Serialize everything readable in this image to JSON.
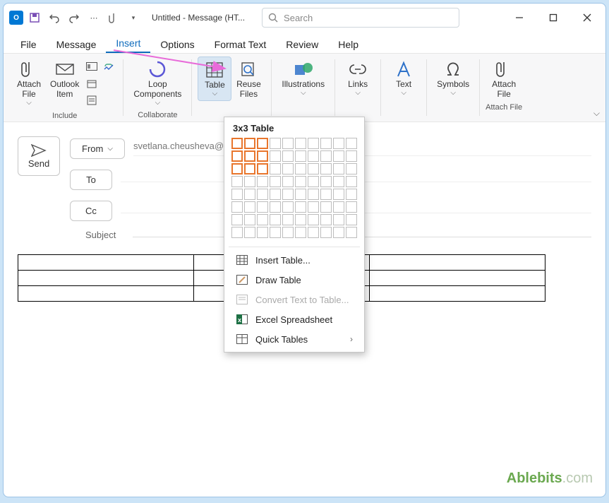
{
  "titlebar": {
    "app_abbr": "O",
    "doc_title": "Untitled - Message (HT...",
    "search_placeholder": "Search"
  },
  "menu": {
    "file": "File",
    "message": "Message",
    "insert": "Insert",
    "options": "Options",
    "format_text": "Format Text",
    "review": "Review",
    "help": "Help"
  },
  "ribbon": {
    "attach_file": "Attach\nFile",
    "outlook_item": "Outlook\nItem",
    "include_label": "Include",
    "loop_components": "Loop\nComponents",
    "collaborate_label": "Collaborate",
    "table": "Table",
    "reuse_files": "Reuse\nFiles",
    "illustrations": "Illustrations",
    "links": "Links",
    "text": "Text",
    "symbols": "Symbols",
    "attach_file2": "Attach\nFile",
    "attach_file_label": "Attach File"
  },
  "compose": {
    "send": "Send",
    "from": "From",
    "to": "To",
    "cc": "Cc",
    "subject": "Subject",
    "from_value": "svetlana.cheusheva@"
  },
  "table_dd": {
    "title": "3x3 Table",
    "sel_rows": 3,
    "sel_cols": 3,
    "insert_table": "Insert Table...",
    "draw_table": "Draw Table",
    "convert_text": "Convert Text to Table...",
    "excel": "Excel Spreadsheet",
    "quick_tables": "Quick Tables"
  },
  "watermark_brand": "Ablebits",
  "watermark_suffix": ".com"
}
